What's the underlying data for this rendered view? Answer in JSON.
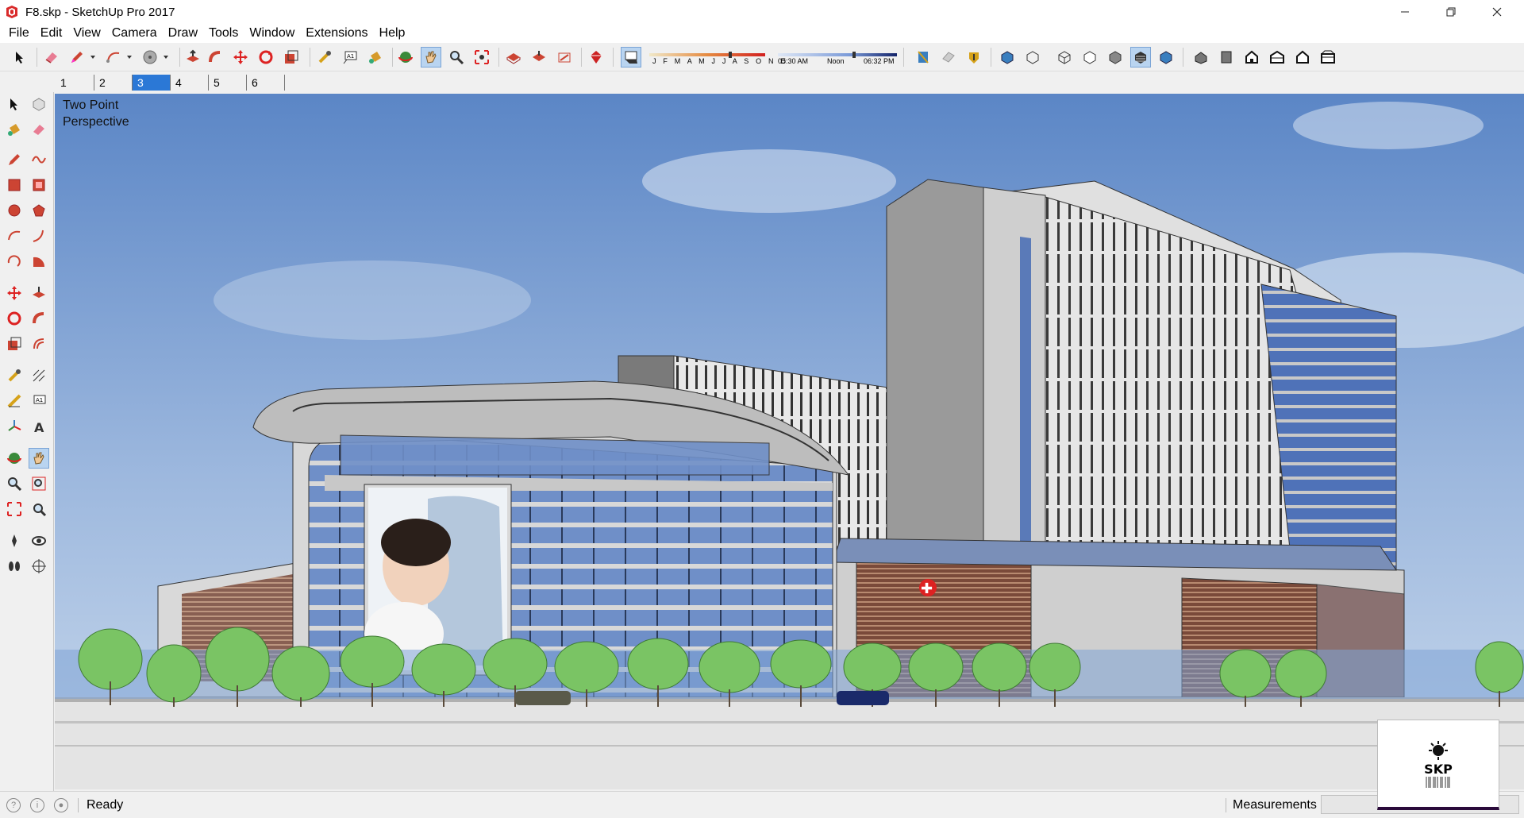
{
  "window": {
    "title": "F8.skp - SketchUp Pro 2017",
    "icon": "sketchup-app-icon",
    "controls": [
      "minimize-icon",
      "restore-icon",
      "close-icon"
    ]
  },
  "menubar": {
    "items": [
      "File",
      "Edit",
      "View",
      "Camera",
      "Draw",
      "Tools",
      "Window",
      "Extensions",
      "Help"
    ]
  },
  "shadows": {
    "months": "J F M A M J J A S O N D",
    "time_start": "05:30 AM",
    "time_mid": "Noon",
    "time_end": "06:32 PM"
  },
  "scenes": {
    "tabs": [
      "1",
      "2",
      "3",
      "4",
      "5",
      "6"
    ],
    "active_index": 2
  },
  "viewport": {
    "camera_label": "Two Point Perspective",
    "sky_top": "#5b86c6",
    "sky_bottom": "#c9d9ec",
    "glass_color": "#6f8fc8",
    "cross_symbol": "✚"
  },
  "status": {
    "text": "Ready",
    "measurements_label": "Measurements",
    "measurements_value": ""
  },
  "watermark": {
    "text": "SKP"
  }
}
